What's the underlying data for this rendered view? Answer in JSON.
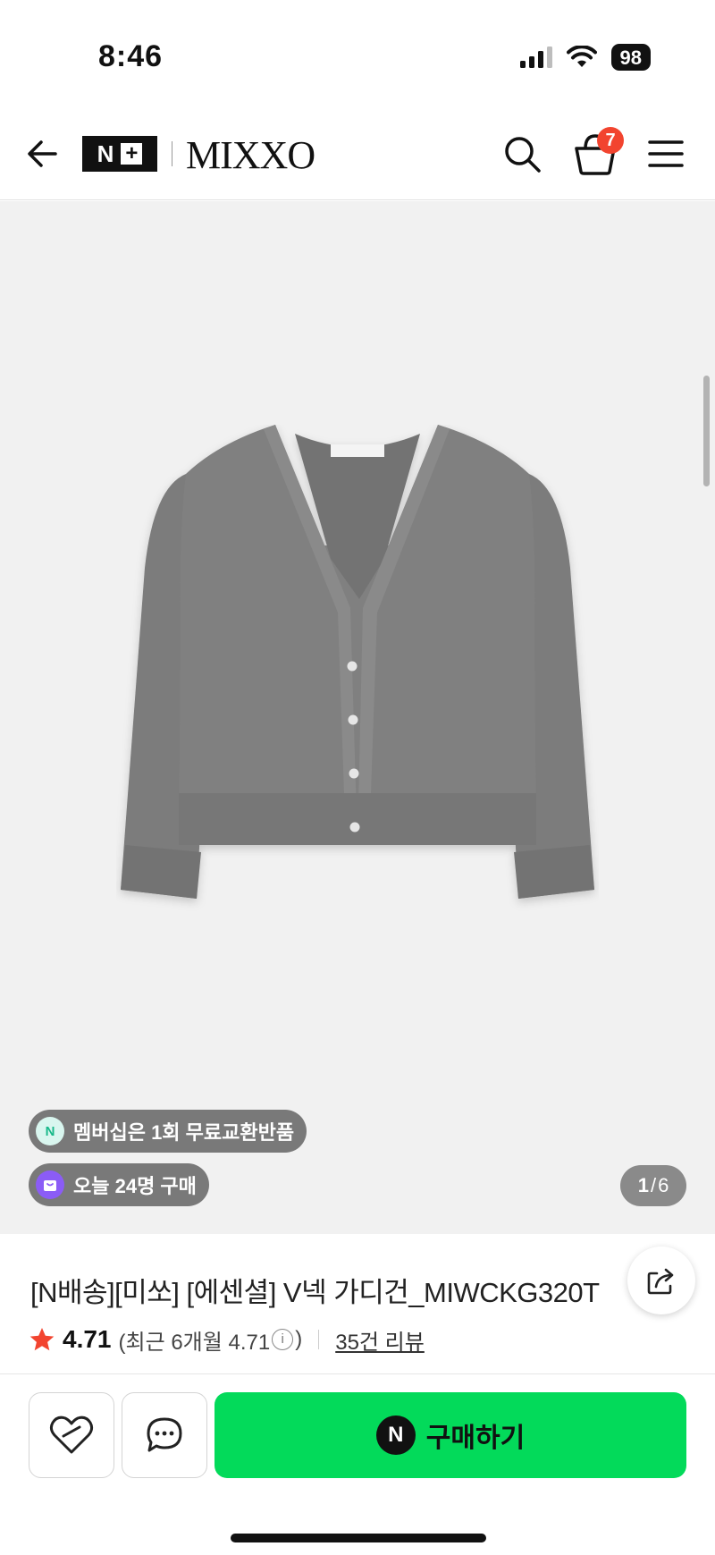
{
  "status_bar": {
    "time": "8:46",
    "battery": "98"
  },
  "header": {
    "nplus_logo": "N",
    "brand": "MIXXO",
    "cart_count": "7"
  },
  "gallery": {
    "membership_pill": "멤버십은 1회 무료교환반품",
    "membership_icon": "N",
    "purchases_pill": "오늘 24명 구매",
    "page_current": "1",
    "page_separator": "/",
    "page_total": "6"
  },
  "product": {
    "title": "[N배송][미쏘] [에센셜] V넥 가디건_MIWCKG320T",
    "rating": "4.71",
    "recent_rating_prefix": "(최근 6개월 4.71",
    "recent_rating_suffix": ")",
    "info_icon": "i",
    "review_link": "35건 리뷰"
  },
  "bottom_bar": {
    "buy_label": "구매하기",
    "buy_icon": "N"
  },
  "colors": {
    "buy_green": "#03da5a",
    "badge_red": "#f2442f",
    "star_red": "#f2442f",
    "image_bg": "#f1f1f1"
  }
}
